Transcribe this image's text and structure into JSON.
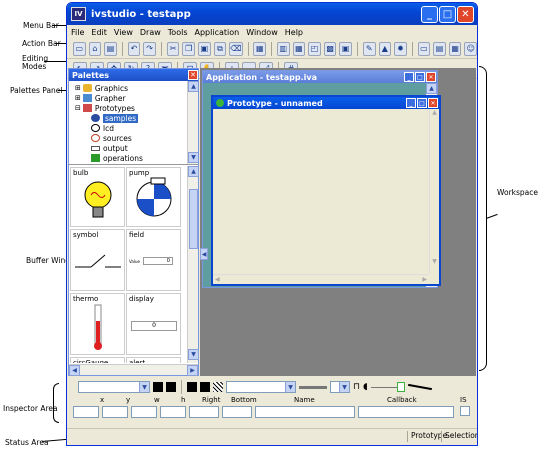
{
  "app": {
    "title": "ivstudio - testapp",
    "icon_text": "IV"
  },
  "menu": [
    "File",
    "Edit",
    "View",
    "Draw",
    "Tools",
    "Application",
    "Window",
    "Help"
  ],
  "palettes": {
    "title": "Palettes",
    "tree": [
      {
        "label": "Graphics",
        "indent": 0,
        "expander": "+"
      },
      {
        "label": "Grapher",
        "indent": 0,
        "expander": "+"
      },
      {
        "label": "Prototypes",
        "indent": 0,
        "expander": "-"
      },
      {
        "label": "samples",
        "indent": 1,
        "selected": true
      },
      {
        "label": "lcd",
        "indent": 1
      },
      {
        "label": "sources",
        "indent": 1
      },
      {
        "label": "output",
        "indent": 1
      },
      {
        "label": "operations",
        "indent": 1
      }
    ],
    "items": [
      "bulb",
      "pump",
      "symbol",
      "field",
      "thermo",
      "display",
      "circGauge",
      "alert"
    ],
    "field_value_label": "Value",
    "field_value": "0",
    "display_value": "0"
  },
  "windows": {
    "application": "Application - testapp.iva",
    "prototype": "Prototype - unnamed"
  },
  "inspector": {
    "headers": [
      "x",
      "y",
      "w",
      "h",
      "Right",
      "Bottom",
      "Name",
      "Callback",
      "IS"
    ]
  },
  "status": [
    "Prototype",
    "Selection"
  ],
  "annotations": {
    "menu_bar": "Menu Bar",
    "action_bar": "Action Bar",
    "editing_modes": "Editing\nModes",
    "palettes_panel": "Palettes Panel",
    "buffer_window": "Buffer Window",
    "workspace": "Workspace",
    "inspector_area": "Inspector Area",
    "status_area": "Status Area"
  },
  "colors": {
    "xp_title": "#0a5fe8",
    "workspace": "#808080",
    "app_bg": "#5f9ea0",
    "proto_bg": "#ecead4",
    "selection": "#316ac5"
  }
}
